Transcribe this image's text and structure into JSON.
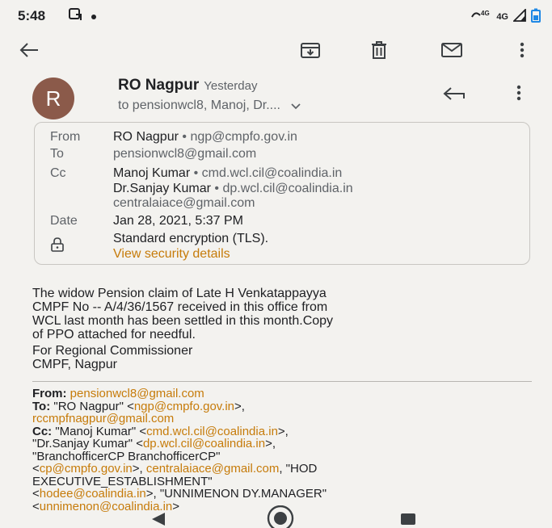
{
  "status_bar": {
    "time": "5:48",
    "network": "4G",
    "network_sup": "4G"
  },
  "toolbar": {
    "back_icon": "arrow-left-icon",
    "archive_icon": "archive-icon",
    "delete_icon": "trash-icon",
    "mark_unread_icon": "mail-icon",
    "more_icon": "more-vert-icon"
  },
  "header": {
    "avatar_letter": "R",
    "sender": "RO Nagpur",
    "when": "Yesterday",
    "recipients": "to pensionwcl8, Manoj, Dr...."
  },
  "details": {
    "from_label": "From",
    "from_name": "RO Nagpur",
    "from_email": "ngp@cmpfo.gov.in",
    "to_label": "To",
    "to_value": "pensionwcl8@gmail.com",
    "cc_label": "Cc",
    "cc_1_name": "Manoj  Kumar",
    "cc_1_email": "cmd.wcl.cil@coalindia.in",
    "cc_2_name": "Dr.Sanjay Kumar",
    "cc_2_email": "dp.wcl.cil@coalindia.in",
    "cc_3": "centralaiace@gmail.com",
    "date_label": "Date",
    "date_value": "Jan 28, 2021, 5:37 PM",
    "encryption": "Standard encryption (TLS).",
    "security_link": "View security details",
    "separator": "•"
  },
  "body": {
    "line1": "The widow Pension claim of Late H Venkatappayya",
    "line2": "CMPF No -- A/4/36/1567 received in this office from",
    "line3": "WCL last month has been settled in this month.Copy",
    "line4": "of PPO attached for needful.",
    "sig1": "For Regional Commissioner",
    "sig2": "CMPF, Nagpur"
  },
  "forwarded": {
    "from_label": "From:",
    "from_email": "pensionwcl8@gmail.com",
    "to_label": "To:",
    "to_name": "\"RO Nagpur\" <",
    "to_email": "ngp@cmpfo.gov.in",
    "to_close": ">,",
    "to_email2": "rccmpfnagpur@gmail.com",
    "cc_label": "Cc:",
    "cc_name1": "\"Manoj Kumar\" <",
    "cc_email1": "cmd.wcl.cil@coalindia.in",
    "cc_close1": ">,",
    "cc_name2": "\"Dr.Sanjay Kumar\" <",
    "cc_email2": "dp.wcl.cil@coalindia.in",
    "cc_close2": ">,",
    "cc_name3": "\"BranchofficerCP BranchofficerCP\"",
    "cc_open3": "<",
    "cc_email3": "cp@cmpfo.gov.in",
    "cc_close3": ">, ",
    "cc_email4": "centralaiace@gmail.com",
    "cc_name5": ", \"HOD",
    "cc_name5b": "EXECUTIVE_ESTABLISHMENT\"",
    "cc_open6": "<",
    "cc_email6": "hodee@coalindia.in",
    "cc_name7": ">, \"UNNIMENON DY.MANAGER\"",
    "cc_open8": "<",
    "cc_email8": "unnimenon@coalindia.in",
    "cc_close8": ">"
  },
  "colors": {
    "accent_link": "#c67b0a",
    "avatar_bg": "#8b5a4a",
    "background": "#f3f2ef",
    "battery": "#1e88e5"
  }
}
